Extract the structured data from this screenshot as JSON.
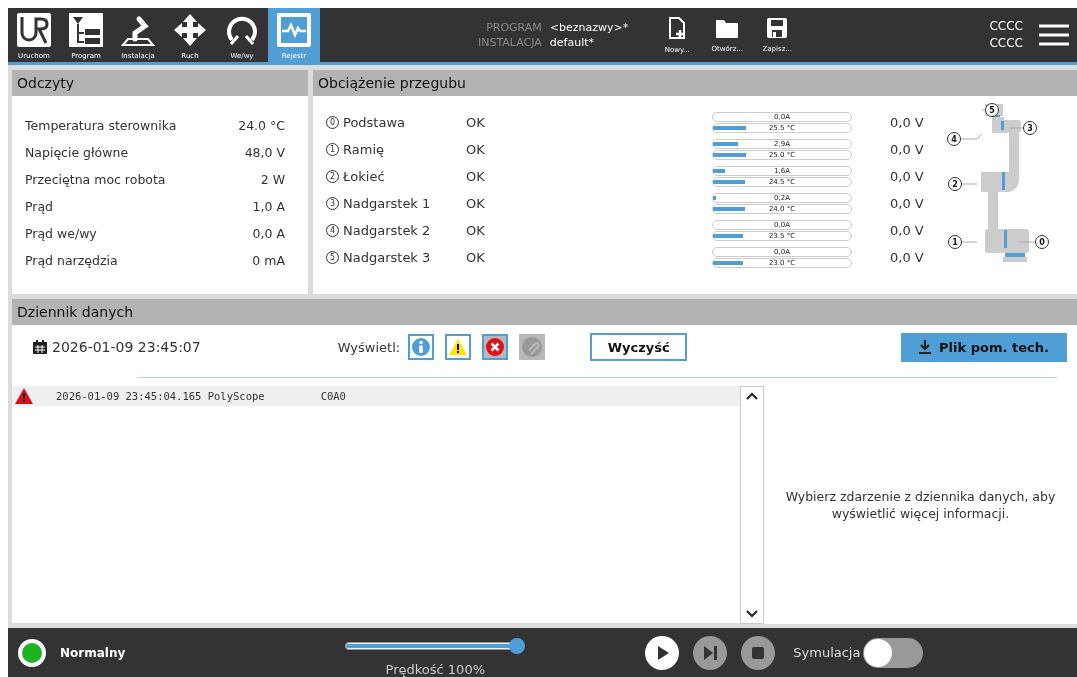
{
  "tabs": [
    {
      "label": "Uruchom",
      "selected": false
    },
    {
      "label": "Program",
      "selected": false
    },
    {
      "label": "Instalacja",
      "selected": false
    },
    {
      "label": "Ruch",
      "selected": false
    },
    {
      "label": "We/wy",
      "selected": false
    },
    {
      "label": "Rejestr",
      "selected": true
    }
  ],
  "program_info": {
    "program_label": "PROGRAM",
    "program_value": "<beznazwy>*",
    "installation_label": "INSTALACJA",
    "installation_value": "default*"
  },
  "file_buttons": [
    {
      "label": "Nowy..."
    },
    {
      "label": "Otwórz..."
    },
    {
      "label": "Zapisz..."
    }
  ],
  "robot_name": [
    "CCCC",
    "CCCC"
  ],
  "readings": {
    "title": "Odczyty",
    "items": [
      {
        "label": "Temperatura sterownika",
        "value": "24.0 °C"
      },
      {
        "label": "Napięcie główne",
        "value": "48,0 V"
      },
      {
        "label": "Przeciętna moc robota",
        "value": "2 W"
      },
      {
        "label": "Prąd",
        "value": "1,0 A"
      },
      {
        "label": "Prąd we/wy",
        "value": "0,0 A"
      },
      {
        "label": "Prąd narzędzia",
        "value": "0 mA"
      }
    ]
  },
  "joint_load": {
    "title": "Obciążenie przegubu",
    "joints": [
      {
        "number": "0",
        "name": "Podstawa",
        "status": "OK",
        "current": {
          "text": "0,0A",
          "level": 0
        },
        "temperature": {
          "text": "25.5 °C",
          "level": 0.24
        },
        "voltage": "0,0 V"
      },
      {
        "number": "1",
        "name": "Ramię",
        "status": "OK",
        "current": {
          "text": "2,9A",
          "level": 0.18
        },
        "temperature": {
          "text": "25.0 °C",
          "level": 0.24
        },
        "voltage": "0,0 V"
      },
      {
        "number": "2",
        "name": "Łokieć",
        "status": "OK",
        "current": {
          "text": "1,6A",
          "level": 0.09
        },
        "temperature": {
          "text": "24.5 °C",
          "level": 0.23
        },
        "voltage": "0,0 V"
      },
      {
        "number": "3",
        "name": "Nadgarstek 1",
        "status": "OK",
        "current": {
          "text": "0,2A",
          "level": 0.02
        },
        "temperature": {
          "text": "24.0 °C",
          "level": 0.23
        },
        "voltage": "0,0 V"
      },
      {
        "number": "4",
        "name": "Nadgarstek 2",
        "status": "OK",
        "current": {
          "text": "0,0A",
          "level": 0
        },
        "temperature": {
          "text": "23.5 °C",
          "level": 0.22
        },
        "voltage": "0,0 V"
      },
      {
        "number": "5",
        "name": "Nadgarstek 3",
        "status": "OK",
        "current": {
          "text": "0,0A",
          "level": 0
        },
        "temperature": {
          "text": "23.0 °C",
          "level": 0.22
        },
        "voltage": "0,0 V"
      }
    ],
    "arm_labels": [
      "5",
      "3",
      "4",
      "2",
      "1",
      "0"
    ]
  },
  "data_log": {
    "title": "Dziennik danych",
    "datetime": "2026-01-09 23:45:07",
    "filter_label": "Wyświetl:",
    "filters": [
      {
        "kind": "info",
        "on": true
      },
      {
        "kind": "warning",
        "on": true
      },
      {
        "kind": "error",
        "on": true
      },
      {
        "kind": "attachment",
        "on": false
      }
    ],
    "clear_button": "Wyczyść",
    "support_button": "Plik pom. tech.",
    "entries": [
      {
        "kind": "warning",
        "text": "2026-01-09 23:45:04.165 PolyScope",
        "code": "C0A0"
      }
    ],
    "detail": "Wybierz zdarzenie z dziennika danych, aby wyświetlić więcej informacji."
  },
  "footer": {
    "status": {
      "text": "Normalny",
      "color": "#1fb31f"
    },
    "speed": {
      "level": 1,
      "label": "Prędkość 100%"
    },
    "simulation_label": "Symulacja",
    "simulation_on": false
  }
}
